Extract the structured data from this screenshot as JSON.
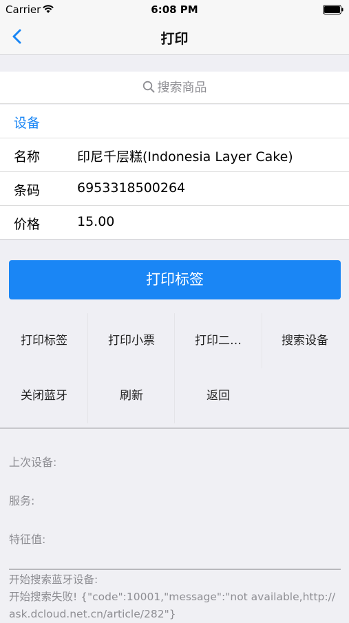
{
  "status_bar": {
    "carrier": "Carrier",
    "time": "6:08 PM"
  },
  "nav": {
    "title": "打印",
    "back_icon": "chevron-left-icon"
  },
  "search": {
    "placeholder": "搜索商品",
    "icon": "search-icon"
  },
  "device_link": "设备",
  "product": [
    {
      "label": "名称",
      "value": "印尼千层糕(Indonesia Layer Cake)"
    },
    {
      "label": "条码",
      "value": "6953318500264"
    },
    {
      "label": "价格",
      "value": "15.00"
    }
  ],
  "primary_button": "打印标签",
  "actions": [
    "打印标签",
    "打印小票",
    "打印二…",
    "搜索设备",
    "关闭蓝牙",
    "刷新",
    "返回"
  ],
  "info": {
    "last_device": "上次设备:",
    "service": "服务:",
    "characteristic": "特征值:"
  },
  "log": {
    "line1": "开始搜索蓝牙设备:",
    "line2": "开始搜索失败! {\"code\":10001,\"message\":\"not available,http://ask.dcloud.net.cn/article/282\"}"
  },
  "colors": {
    "accent": "#1a86f5",
    "background": "#efeff4"
  }
}
